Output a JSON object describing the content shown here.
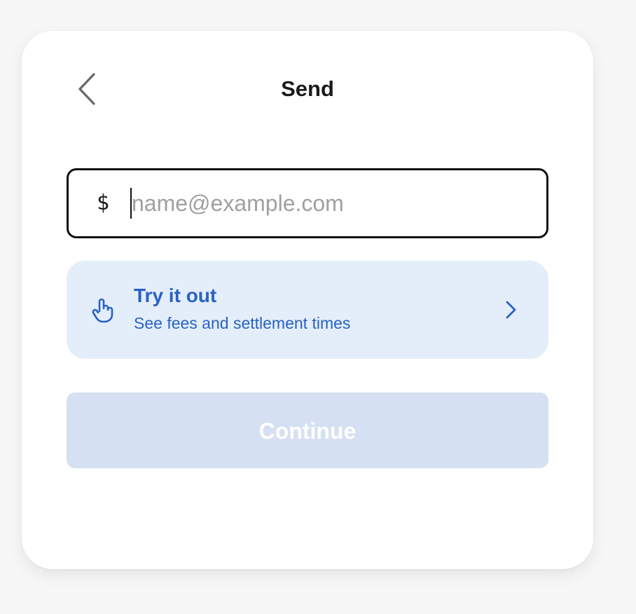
{
  "header": {
    "title": "Send",
    "back_icon": "chevron-left-icon"
  },
  "amount_input": {
    "currency_symbol": "$",
    "value": "",
    "placeholder": "name@example.com"
  },
  "try_card": {
    "icon": "hand-pointer-icon",
    "title": "Try it out",
    "subtitle": "See fees and settlement times",
    "chevron_icon": "chevron-right-icon"
  },
  "continue_button": {
    "label": "Continue",
    "enabled": false
  },
  "colors": {
    "accent": "#2962c4",
    "try_card_bg": "#e4eefa",
    "continue_disabled_bg": "#d5e1f2",
    "page_bg": "#f7f7f7"
  }
}
